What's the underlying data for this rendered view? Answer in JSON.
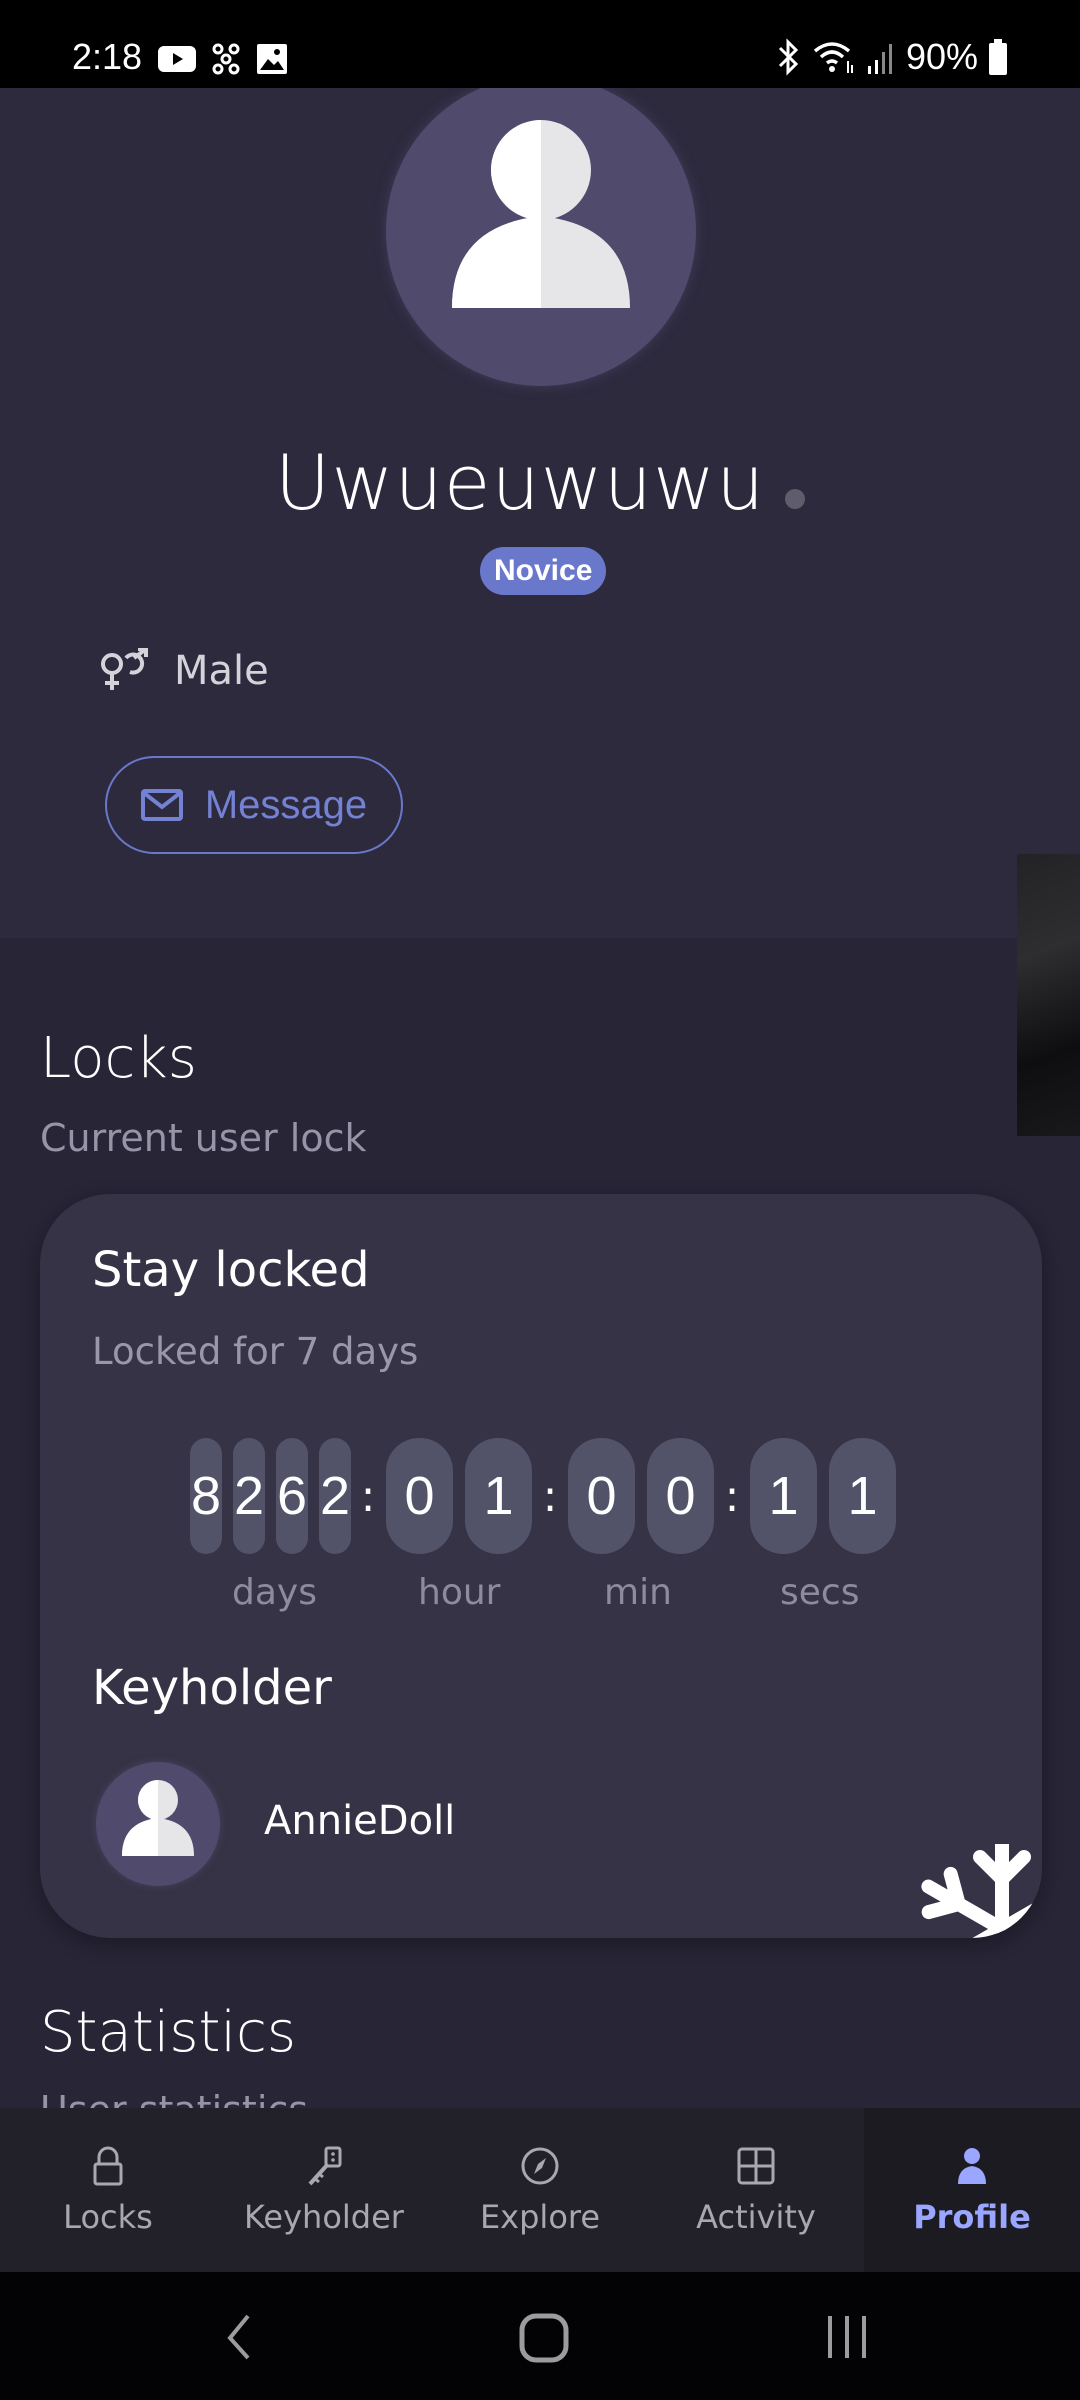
{
  "status_bar": {
    "time": "2:18",
    "left_icons": [
      "youtube-icon",
      "app-icon",
      "gallery-icon"
    ],
    "right_icons": [
      "bluetooth-icon",
      "wifi-icon",
      "signal-icon"
    ],
    "battery": "90%"
  },
  "profile": {
    "username": "Uwueuwuwu",
    "online_status": "offline",
    "level_badge": "Novice",
    "gender_icon": "gender-icon",
    "gender": "Male",
    "message_button": "Message",
    "colors": {
      "accent": "#6a78cc",
      "badge": "#6a78cc"
    }
  },
  "locks": {
    "title": "Locks",
    "subtitle": "Current user lock",
    "card": {
      "title": "Stay locked",
      "subtitle": "Locked for 7 days",
      "timer": {
        "days": [
          "8",
          "2",
          "6",
          "2"
        ],
        "hours": [
          "0",
          "1"
        ],
        "minutes": [
          "0",
          "0"
        ],
        "seconds": [
          "1",
          "1"
        ],
        "separator": ":",
        "labels": {
          "days": "days",
          "hours": "hour",
          "minutes": "min",
          "seconds": "secs"
        }
      },
      "keyholder_title": "Keyholder",
      "keyholder_name": "AnnieDoll",
      "frozen_icon": "snowflake-icon"
    }
  },
  "statistics": {
    "title": "Statistics",
    "subtitle": "User statistics"
  },
  "bottom_nav": {
    "items": [
      {
        "label": "Locks",
        "icon": "lock-icon",
        "active": false
      },
      {
        "label": "Keyholder",
        "icon": "key-icon",
        "active": false
      },
      {
        "label": "Explore",
        "icon": "compass-icon",
        "active": false
      },
      {
        "label": "Activity",
        "icon": "grid-icon",
        "active": false
      },
      {
        "label": "Profile",
        "icon": "person-icon",
        "active": true
      }
    ],
    "active_color": "#9aa6ff"
  }
}
